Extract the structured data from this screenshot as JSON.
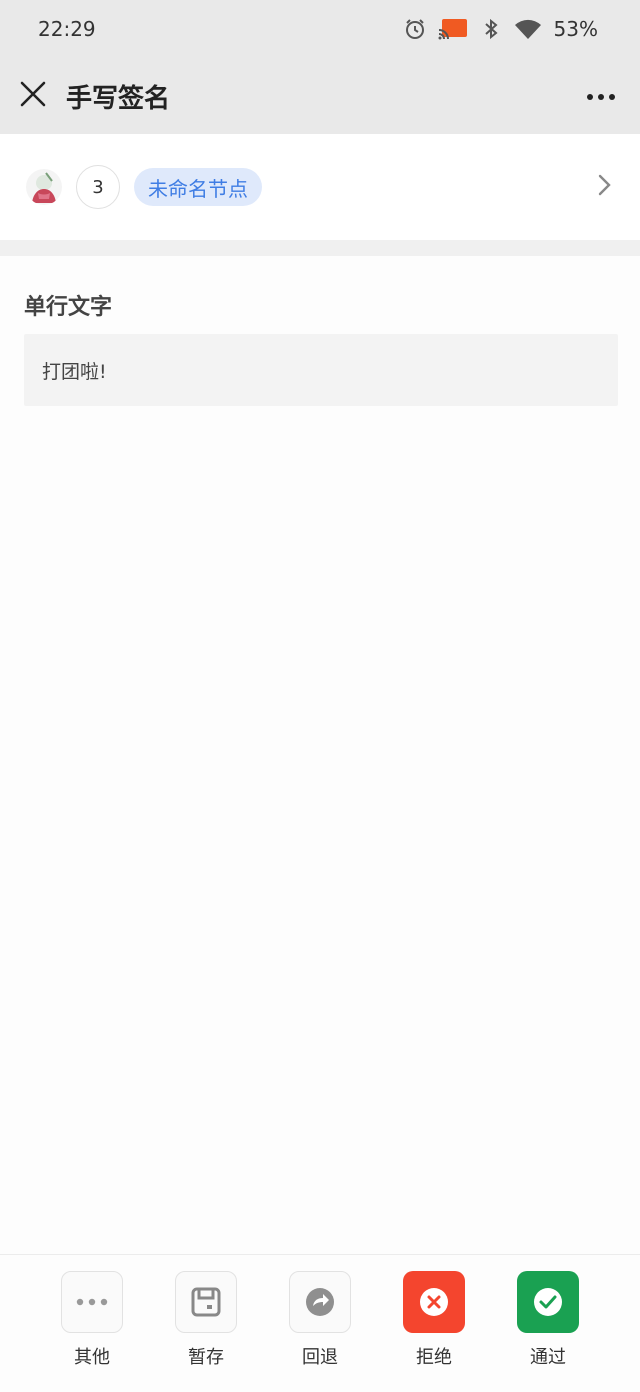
{
  "status_bar": {
    "time": "22:29",
    "battery": "53%"
  },
  "nav": {
    "title": "手写签名"
  },
  "node": {
    "step": "3",
    "tag": "未命名节点"
  },
  "form": {
    "field_label": "单行文字",
    "field_value": "打团啦!"
  },
  "actions": [
    {
      "label": "其他",
      "icon": "more-icon"
    },
    {
      "label": "暂存",
      "icon": "save-icon"
    },
    {
      "label": "回退",
      "icon": "return-icon"
    },
    {
      "label": "拒绝",
      "icon": "reject-icon"
    },
    {
      "label": "通过",
      "icon": "check-icon"
    }
  ],
  "colors": {
    "accent": "#3f7de4",
    "tag_bg": "#dfe9fb",
    "reject": "#f4452e",
    "pass": "#1aa152"
  }
}
